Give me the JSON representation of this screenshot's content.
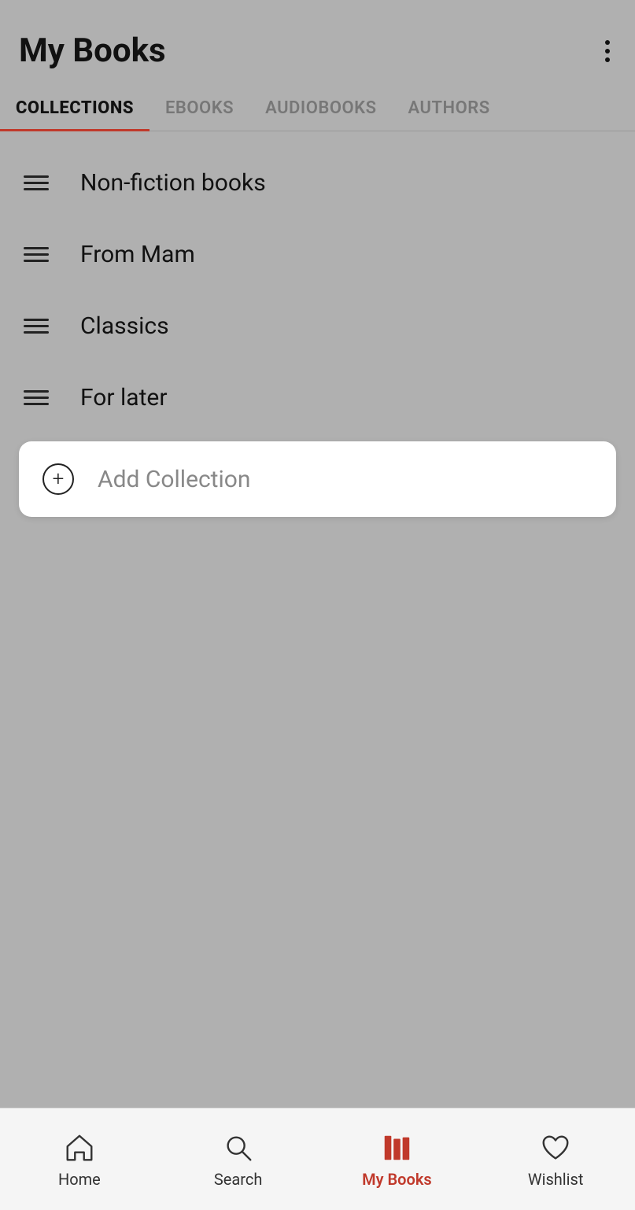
{
  "header": {
    "title": "My Books",
    "menu_icon_label": "more-options"
  },
  "tabs": [
    {
      "id": "collections",
      "label": "COLLECTIONS",
      "active": true
    },
    {
      "id": "ebooks",
      "label": "EBOOKS",
      "active": false
    },
    {
      "id": "audiobooks",
      "label": "AUDIOBOOKS",
      "active": false
    },
    {
      "id": "authors",
      "label": "AUTHORS",
      "active": false
    }
  ],
  "collections": [
    {
      "id": 1,
      "name": "Non-fiction books"
    },
    {
      "id": 2,
      "name": "From Mam"
    },
    {
      "id": 3,
      "name": "Classics"
    },
    {
      "id": 4,
      "name": "For later"
    }
  ],
  "add_collection_label": "Add Collection",
  "bottom_nav": [
    {
      "id": "home",
      "label": "Home",
      "active": false
    },
    {
      "id": "search",
      "label": "Search",
      "active": false
    },
    {
      "id": "mybooks",
      "label": "My Books",
      "active": true
    },
    {
      "id": "wishlist",
      "label": "Wishlist",
      "active": false
    }
  ],
  "colors": {
    "active_tab_underline": "#c0392b",
    "active_nav": "#c0392b",
    "background": "#b0b0b0"
  }
}
